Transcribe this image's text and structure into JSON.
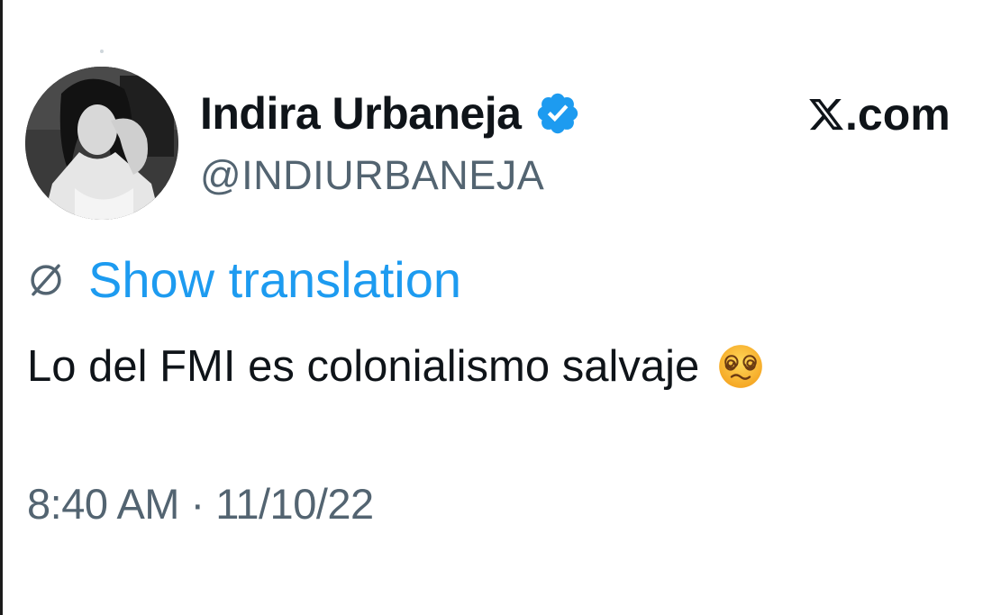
{
  "tweet": {
    "display_name": "Indira Urbaneja",
    "handle": "@INDIURBANEJA",
    "brand": ".com",
    "translate_label": "Show translation",
    "text": "Lo del FMI es colonialismo salvaje",
    "timestamp": "8:40 AM · 11/10/22"
  },
  "icons": {
    "verified": "verified-badge-icon",
    "brand_logo": "x-logo-icon",
    "translate": "globe-icon",
    "emoji": "dizzy-face-emoji-icon"
  },
  "colors": {
    "link_blue": "#1d9bf0",
    "secondary_text": "#536471",
    "primary_text": "#0f1419"
  }
}
